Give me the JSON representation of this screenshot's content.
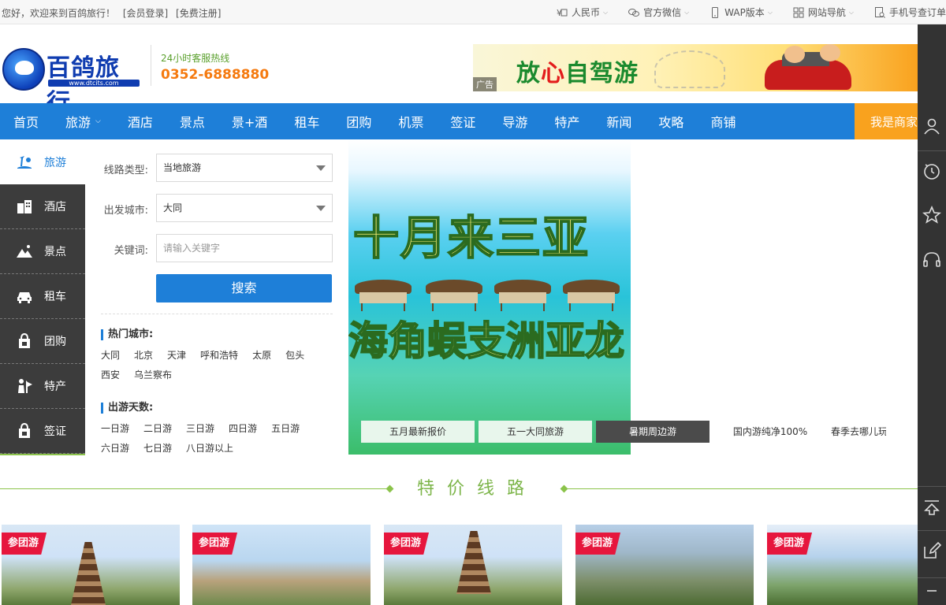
{
  "topbar": {
    "welcome": "您好，欢迎来到百鸽旅行！",
    "login": "[会员登录]",
    "register": "[免费注册]",
    "items": [
      {
        "icon": "currency-icon",
        "label": "人民币",
        "dropdown": true
      },
      {
        "icon": "wechat-icon",
        "label": "官方微信",
        "dropdown": true
      },
      {
        "icon": "phone-icon",
        "label": "WAP版本",
        "dropdown": true
      },
      {
        "icon": "grid-icon",
        "label": "网站导航",
        "dropdown": true
      },
      {
        "icon": "order-icon",
        "label": "手机号查订单",
        "dropdown": false
      }
    ]
  },
  "header": {
    "logo_text": "百鸽旅行",
    "logo_url": "www.dtcits.com",
    "hotline_label": "24小时客服热线",
    "hotline_number": "0352-6888880",
    "ad": {
      "text_a": "放",
      "text_red": "心",
      "text_b": "自驾游",
      "label": "广告"
    }
  },
  "nav": {
    "items": [
      "首页",
      "旅游",
      "酒店",
      "景点",
      "景+酒",
      "租车",
      "团购",
      "机票",
      "签证",
      "导游",
      "特产",
      "新闻",
      "攻略",
      "商铺"
    ],
    "dropdown_index": 1,
    "shop_label": "我是商家"
  },
  "left_menu": [
    {
      "label": "旅游",
      "icon": "travel-icon",
      "active": true
    },
    {
      "label": "酒店",
      "icon": "hotel-icon",
      "active": false
    },
    {
      "label": "景点",
      "icon": "scenery-icon",
      "active": false
    },
    {
      "label": "租车",
      "icon": "car-icon",
      "active": false
    },
    {
      "label": "团购",
      "icon": "groupbuy-icon",
      "active": false
    },
    {
      "label": "特产",
      "icon": "specialty-icon",
      "active": false
    },
    {
      "label": "签证",
      "icon": "visa-icon",
      "active": false
    }
  ],
  "search": {
    "route_type_label": "线路类型:",
    "route_type_value": "当地旅游",
    "city_label": "出发城市:",
    "city_value": "大同",
    "keyword_label": "关键词:",
    "keyword_placeholder": "请输入关键字",
    "button": "搜索",
    "hot_cities_title": "热门城市:",
    "hot_cities": [
      "大同",
      "北京",
      "天津",
      "呼和浩特",
      "太原",
      "包头",
      "西安",
      "乌兰察布"
    ],
    "days_title": "出游天数:",
    "days": [
      "一日游",
      "二日游",
      "三日游",
      "四日游",
      "五日游",
      "六日游",
      "七日游",
      "八日游以上"
    ]
  },
  "slider": {
    "line1": "十月来三亚",
    "line2": "海角蜈支洲亚龙",
    "tabs": [
      "五月最新报价",
      "五一大同旅游",
      "暑期周边游",
      "国内游纯净100%",
      "春季去哪儿玩"
    ],
    "active_tab": 2
  },
  "section": {
    "title": "特价线路"
  },
  "cards": [
    {
      "tag": "参团游"
    },
    {
      "tag": "参团游"
    },
    {
      "tag": "参团游"
    },
    {
      "tag": "参团游"
    },
    {
      "tag": "参团游"
    }
  ],
  "right_sidebar": {
    "icons": [
      "user-icon",
      "history-icon",
      "star-icon",
      "headset-icon",
      "back-to-top-icon",
      "edit-icon",
      "minus-icon"
    ]
  },
  "colors": {
    "brand_blue": "#1e7fd8",
    "accent_orange": "#f9a21e",
    "hotline_orange": "#f57a0f",
    "section_green": "#7db54a",
    "tag_red": "#e6163d"
  }
}
